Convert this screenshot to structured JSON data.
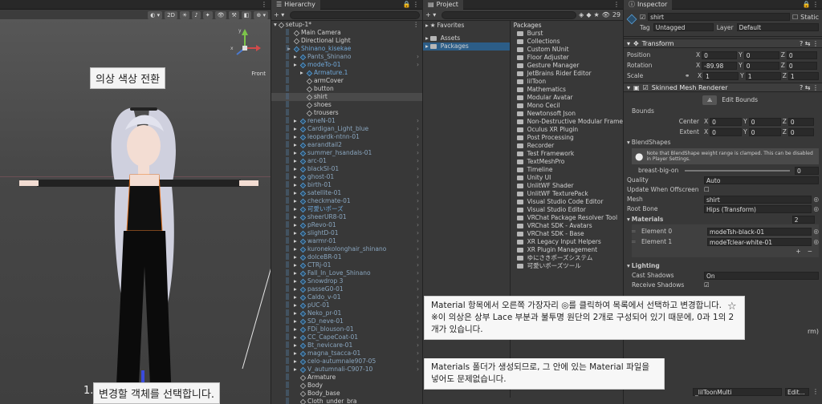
{
  "scene": {
    "toolbar_2d": "2D",
    "gizmo_label": "Front",
    "callout_top": "의상 색상 전환",
    "callout_bottom_num": "1.",
    "callout_bottom": "변경할 객체를 선택합니다."
  },
  "hierarchy": {
    "title": "Hierarchy",
    "root": "setup-1*",
    "items": [
      {
        "label": "Main Camera",
        "indent": 1,
        "blue": false
      },
      {
        "label": "Directional Light",
        "indent": 1,
        "blue": false
      },
      {
        "label": "Shinano_kisekae",
        "indent": 1,
        "blue": true
      },
      {
        "label": "Pants_Shinano",
        "indent": 2,
        "blue": true,
        "dim": true
      },
      {
        "label": "modeTo-01",
        "indent": 2,
        "blue": true
      },
      {
        "label": "Armature.1",
        "indent": 3,
        "blue": true
      },
      {
        "label": "armCover",
        "indent": 3,
        "blue": false
      },
      {
        "label": "button",
        "indent": 3,
        "blue": false
      },
      {
        "label": "shirt",
        "indent": 3,
        "blue": false,
        "sel": true
      },
      {
        "label": "shoes",
        "indent": 3,
        "blue": false
      },
      {
        "label": "trousers",
        "indent": 3,
        "blue": false
      },
      {
        "label": "reneN-01",
        "indent": 2,
        "blue": true,
        "dim": true
      },
      {
        "label": "Cardigan_Light_blue",
        "indent": 2,
        "blue": true,
        "dim": true
      },
      {
        "label": "leopardk-ntnn-01",
        "indent": 2,
        "blue": true,
        "dim": true
      },
      {
        "label": "earandtail2",
        "indent": 2,
        "blue": true,
        "dim": true
      },
      {
        "label": "summer_hsandals-01",
        "indent": 2,
        "blue": true,
        "dim": true
      },
      {
        "label": "arc-01",
        "indent": 2,
        "blue": true,
        "dim": true
      },
      {
        "label": "blackSI-01",
        "indent": 2,
        "blue": true,
        "dim": true
      },
      {
        "label": "ghost-01",
        "indent": 2,
        "blue": true,
        "dim": true
      },
      {
        "label": "birth-01",
        "indent": 2,
        "blue": true,
        "dim": true
      },
      {
        "label": "satellite-01",
        "indent": 2,
        "blue": true,
        "dim": true
      },
      {
        "label": "checkmate-01",
        "indent": 2,
        "blue": true,
        "dim": true
      },
      {
        "label": "可愛いポーズ",
        "indent": 2,
        "blue": true
      },
      {
        "label": "sheerUR8-01",
        "indent": 2,
        "blue": true,
        "dim": true
      },
      {
        "label": "pRevo-01",
        "indent": 2,
        "blue": true,
        "dim": true
      },
      {
        "label": "slightD-01",
        "indent": 2,
        "blue": true,
        "dim": true
      },
      {
        "label": "warmr-01",
        "indent": 2,
        "blue": true,
        "dim": true
      },
      {
        "label": "kuronekolonghair_shinano",
        "indent": 2,
        "blue": true,
        "dim": true
      },
      {
        "label": "dolceBR-01",
        "indent": 2,
        "blue": true,
        "dim": true
      },
      {
        "label": "CTRj-01",
        "indent": 2,
        "blue": true,
        "dim": true
      },
      {
        "label": "Fall_In_Love_Shinano",
        "indent": 2,
        "blue": true,
        "dim": true
      },
      {
        "label": "Snowdrop 3",
        "indent": 2,
        "blue": true,
        "dim": true
      },
      {
        "label": "passeG0-01",
        "indent": 2,
        "blue": true,
        "dim": true
      },
      {
        "label": "Caldo_v-01",
        "indent": 2,
        "blue": true,
        "dim": true
      },
      {
        "label": "pUC-01",
        "indent": 2,
        "blue": true,
        "dim": true
      },
      {
        "label": "Neko_pr-01",
        "indent": 2,
        "blue": true,
        "dim": true
      },
      {
        "label": "SD_neve-01",
        "indent": 2,
        "blue": true,
        "dim": true
      },
      {
        "label": "FDi_blouson-01",
        "indent": 2,
        "blue": true,
        "dim": true
      },
      {
        "label": "CC_CapeCoat-01",
        "indent": 2,
        "blue": true,
        "dim": true
      },
      {
        "label": "Bt_nevicare-01",
        "indent": 2,
        "blue": true,
        "dim": true
      },
      {
        "label": "magna_tsacca-01",
        "indent": 2,
        "blue": true,
        "dim": true
      },
      {
        "label": "celo-autumnale907-05",
        "indent": 2,
        "blue": true,
        "dim": true
      },
      {
        "label": "V_autumnali-C907-10",
        "indent": 2,
        "blue": true,
        "dim": true
      },
      {
        "label": "Armature",
        "indent": 2,
        "blue": false
      },
      {
        "label": "Body",
        "indent": 2,
        "blue": false
      },
      {
        "label": "Body_base",
        "indent": 2,
        "blue": false
      },
      {
        "label": "Cloth_under_bra",
        "indent": 2,
        "blue": false
      }
    ]
  },
  "project": {
    "title": "Project",
    "count": "29",
    "favorites": "Favorites",
    "tree": [
      "Assets",
      "Packages"
    ],
    "packages_header": "Packages",
    "packages": [
      "Burst",
      "Collections",
      "Custom NUnit",
      "Floor Adjuster",
      "Gesture Manager",
      "JetBrains Rider Editor",
      "lilToon",
      "Mathematics",
      "Modular Avatar",
      "Mono Cecil",
      "Newtonsoft Json",
      "Non-Destructive Modular Frame",
      "Oculus XR Plugin",
      "Post Processing",
      "Recorder",
      "Test Framework",
      "TextMeshPro",
      "Timeline",
      "Unity UI",
      "UnlitWF Shader",
      "UnlitWF TexturePack",
      "Visual Studio Code Editor",
      "Visual Studio Editor",
      "VRChat Package Resolver Tool",
      "VRChat SDK - Avatars",
      "VRChat SDK - Base",
      "XR Legacy Input Helpers",
      "XR Plugin Management",
      "ゆにさきポーズシステム",
      "可愛いポーズツール"
    ]
  },
  "inspector": {
    "title": "Inspector",
    "object_name": "shirt",
    "static_label": "Static",
    "tag_label": "Tag",
    "tag_value": "Untagged",
    "layer_label": "Layer",
    "layer_value": "Default",
    "transform": "Transform",
    "position": "Position",
    "rotation": "Rotation",
    "scale": "Scale",
    "pos": [
      "0",
      "0",
      "0"
    ],
    "rot": [
      "-89.98",
      "0",
      "0"
    ],
    "scl": [
      "1",
      "1",
      "1"
    ],
    "smr": "Skinned Mesh Renderer",
    "edit_bounds": "Edit Bounds",
    "bounds": "Bounds",
    "center": "Center",
    "extent": "Extent",
    "center_v": [
      "0",
      "0",
      "0"
    ],
    "extent_v": [
      "0",
      "0",
      "0"
    ],
    "blendshapes": "BlendShapes",
    "blend_note": "Note that BlendShape weight range is clamped. This can be disabled in Player Settings.",
    "breast_label": "breast-big-on",
    "breast_value": "0",
    "quality": "Quality",
    "quality_v": "Auto",
    "update_offscreen": "Update When Offscreen",
    "mesh": "Mesh",
    "mesh_v": "shirt",
    "root_bone": "Root Bone",
    "root_bone_v": "Hips (Transform)",
    "materials": "Materials",
    "materials_count": "2",
    "element0": "Element 0",
    "element0_v": "modeTsh-black-01",
    "element1": "Element 1",
    "element1_v": "modeTclear-white-01",
    "lighting": "Lighting",
    "cast_shadows": "Cast Shadows",
    "cast_shadows_v": "On",
    "receive_shadows": "Receive Shadows",
    "rm_suffix": "rm)",
    "bottom_dd": "_lilToonMulti",
    "bottom_edit": "Edit..."
  },
  "notes": {
    "note1": "Material 항목에서 오른쪽 가장자리 ◎를 클릭하여 목록에서 선택하고 변경합니다.\n※이 의상은 상부 Lace 부분과 불투명 원단의 2개로 구성되어 있기 때문에, 0과 1의 2개가 있습니다.",
    "note2": "Materials 폴더가 생성되므로, 그 안에 있는 Material 파일을 넣어도 문제없습니다.",
    "star": "☆"
  }
}
